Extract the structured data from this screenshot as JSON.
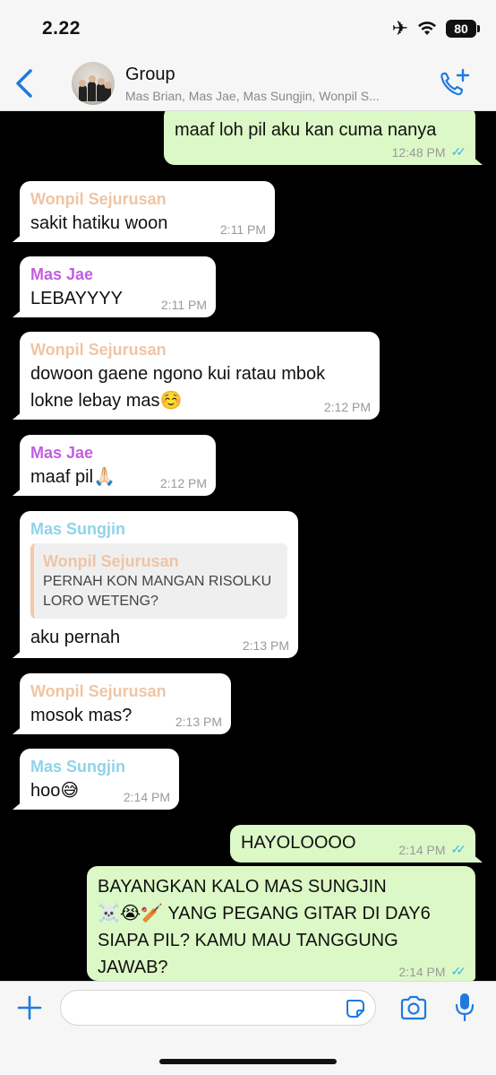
{
  "status_bar": {
    "time": "2.22",
    "battery": "80"
  },
  "header": {
    "title": "Group",
    "subtitle": "Mas Brian, Mas Jae, Mas Sungjin, Wonpil S..."
  },
  "messages": [
    {
      "direction": "out",
      "text": "maaf loh pil aku kan cuma nanya",
      "time": "12:48 PM"
    },
    {
      "direction": "in",
      "sender": "Wonpil Sejurusan",
      "sender_color": "#f0c4a4",
      "text": "sakit hatiku woon",
      "time": "2:11 PM"
    },
    {
      "direction": "in",
      "sender": "Mas Jae",
      "sender_color": "#c35ee0",
      "text": "LEBAYYYY",
      "time": "2:11 PM"
    },
    {
      "direction": "in",
      "sender": "Wonpil Sejurusan",
      "sender_color": "#f0c4a4",
      "text_line1": "dowoon gaene ngono kui ratau mbok",
      "text_line2": "lokne lebay mas☺️",
      "time": "2:12 PM"
    },
    {
      "direction": "in",
      "sender": "Mas Jae",
      "sender_color": "#c35ee0",
      "text": "maaf pil🙏🏻",
      "time": "2:12 PM"
    },
    {
      "direction": "in",
      "sender": "Mas Sungjin",
      "sender_color": "#8fd3ea",
      "quote_sender": "Wonpil Sejurusan",
      "quote_line1": "PERNAH KON MANGAN RISOLKU",
      "quote_line2": "LORO WETENG?",
      "text": "aku pernah",
      "time": "2:13 PM"
    },
    {
      "direction": "in",
      "sender": "Wonpil Sejurusan",
      "sender_color": "#f0c4a4",
      "text": "mosok mas?",
      "time": "2:13 PM"
    },
    {
      "direction": "in",
      "sender": "Mas Sungjin",
      "sender_color": "#8fd3ea",
      "text": "hoo😅",
      "time": "2:14 PM"
    },
    {
      "direction": "out",
      "text": "HAYOLOOOO",
      "time": "2:14 PM"
    },
    {
      "direction": "out",
      "text_line1": "BAYANGKAN KALO MAS SUNGJIN",
      "text_line2": "☠️😭🏏 YANG PEGANG GITAR DI DAY6",
      "text_line3": "SIAPA PIL? KAMU MAU TANGGUNG",
      "text_line4": "JAWAB?",
      "time": "2:14 PM"
    }
  ],
  "icons": {
    "back": "chevron-left-icon",
    "call": "add-call-icon",
    "plus": "plus-icon",
    "sticker": "sticker-icon",
    "camera": "camera-icon",
    "mic": "microphone-icon"
  },
  "colors": {
    "accent": "#1f7ae0",
    "out_bubble": "#dcf8c6",
    "read_ticks": "#34b7f1",
    "chat_bg": "#000000"
  }
}
